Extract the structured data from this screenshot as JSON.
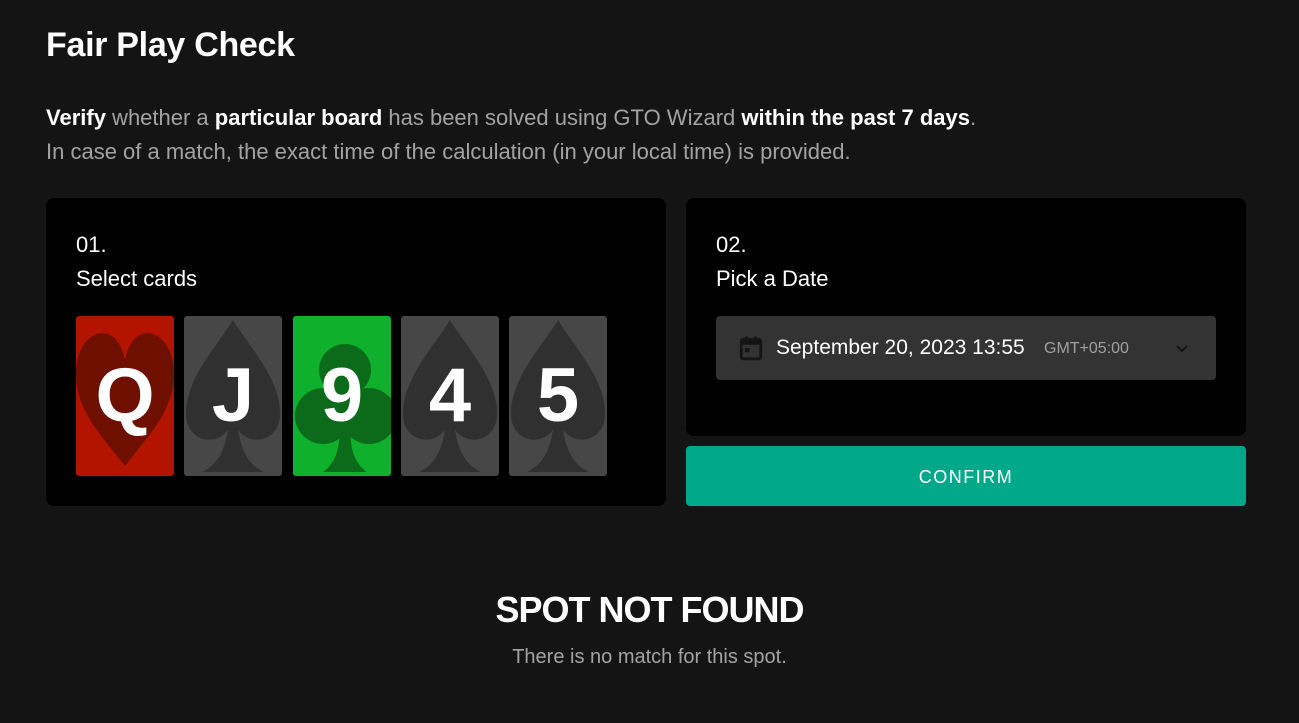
{
  "page": {
    "title": "Fair Play Check",
    "description": {
      "line1": [
        {
          "text": "Verify",
          "bold": true
        },
        {
          "text": " whether a ",
          "bold": false
        },
        {
          "text": "particular board",
          "bold": true
        },
        {
          "text": " has been solved using GTO Wizard ",
          "bold": false
        },
        {
          "text": "within the past 7 days",
          "bold": true
        },
        {
          "text": ".",
          "bold": false
        }
      ],
      "line2": "In case of a match, the exact time of the calculation (in your local time) is provided."
    }
  },
  "step1": {
    "number": "01.",
    "label": "Select cards",
    "cards": [
      {
        "rank": "Q",
        "suit": "heart",
        "bg": "#b31400",
        "suit_color": "#6e0f00"
      },
      {
        "rank": "J",
        "suit": "spade",
        "bg": "#474747",
        "suit_color": "#303030"
      },
      {
        "rank": "9",
        "suit": "club",
        "bg": "#0fb02c",
        "suit_color": "#0b6b1b"
      },
      {
        "rank": "4",
        "suit": "spade",
        "bg": "#474747",
        "suit_color": "#303030"
      },
      {
        "rank": "5",
        "suit": "spade",
        "bg": "#474747",
        "suit_color": "#303030"
      }
    ]
  },
  "step2": {
    "number": "02.",
    "label": "Pick a Date",
    "date_value": "September 20, 2023 13:55",
    "timezone": "GMT+05:00",
    "icon": "calendar-icon"
  },
  "confirm_label": "CONFIRM",
  "result": {
    "title": "SPOT NOT FOUND",
    "subtitle": "There is no match for this spot."
  },
  "colors": {
    "background": "#141414",
    "panel": "#000000",
    "accent": "#02a88a",
    "muted_text": "#a3a3a3"
  }
}
